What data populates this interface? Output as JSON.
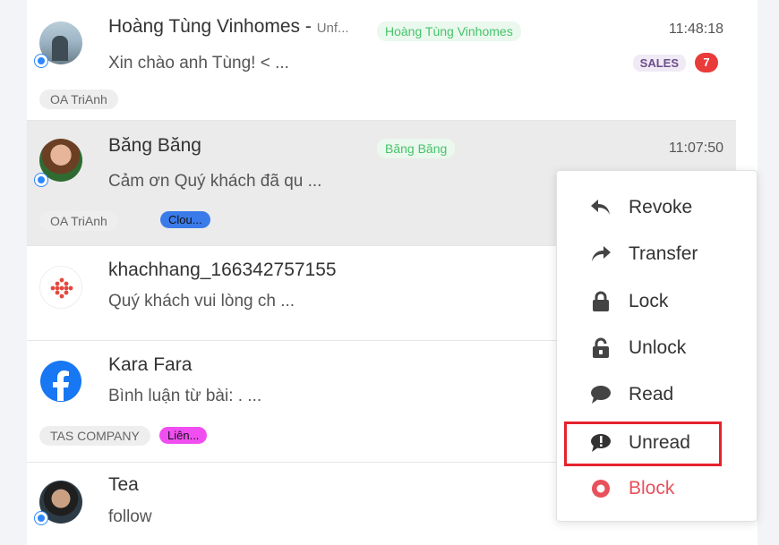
{
  "conversations": [
    {
      "name": "Hoàng Tùng Vinhomes -",
      "name_suffix": "Unf...",
      "tag": "Hoàng Tùng Vinhomes",
      "time": "11:48:18",
      "preview": "Xin chào anh Tùng! < ...",
      "label": "SALES",
      "unread_count": "7",
      "oa": "OA TriAnh"
    },
    {
      "name": "Băng Băng",
      "tag": "Băng Băng",
      "time": "11:07:50",
      "preview": "Cảm ơn Quý khách đã qu ...",
      "oa": "OA TriAnh",
      "pill": "Clou..."
    },
    {
      "name": "khachhang_166342757155",
      "preview": "Quý khách vui lòng ch ..."
    },
    {
      "name": "Kara Fara",
      "preview": "Bình luận từ bài: . ...",
      "oa": "TAS COMPANY",
      "pill": "Liên..."
    },
    {
      "name": "Tea",
      "preview": "follow"
    }
  ],
  "context_menu": {
    "items": [
      {
        "label": "Revoke",
        "icon": "revoke-icon"
      },
      {
        "label": "Transfer",
        "icon": "transfer-icon"
      },
      {
        "label": "Lock",
        "icon": "lock-icon"
      },
      {
        "label": "Unlock",
        "icon": "unlock-icon"
      },
      {
        "label": "Read",
        "icon": "read-icon"
      },
      {
        "label": "Unread",
        "icon": "unread-icon"
      },
      {
        "label": "Block",
        "icon": "block-icon"
      }
    ]
  },
  "colors": {
    "highlight_border": "#e5222d",
    "block_red": "#e8505b",
    "zalo_blue": "#2d88ff",
    "facebook_blue": "#1877f2"
  }
}
